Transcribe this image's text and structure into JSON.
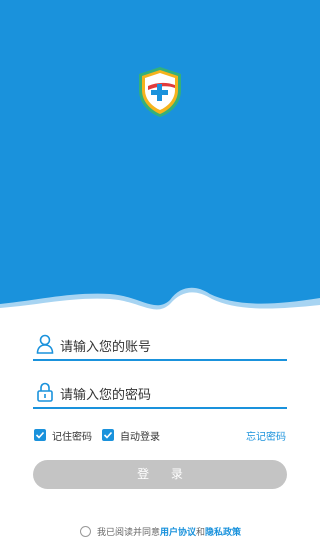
{
  "header": {
    "logo_icon": "shield-plus-icon"
  },
  "login_form": {
    "username_icon": "user-icon",
    "username_placeholder": "请输入您的账号",
    "password_icon": "lock-icon",
    "password_placeholder": "请输入您的密码",
    "remember_label": "记住密码",
    "remember_checked": true,
    "auto_login_label": "自动登录",
    "auto_login_checked": true,
    "forgot_label": "忘记密码",
    "login_button": "登 录"
  },
  "agreement": {
    "prefix": "我已阅读并同意",
    "user_agreement": "用户协议",
    "connector": "和",
    "privacy_policy": "隐私政策",
    "agreed": false
  },
  "colors": {
    "primary": "#1a92dc",
    "button_disabled": "#c4c4c4"
  }
}
